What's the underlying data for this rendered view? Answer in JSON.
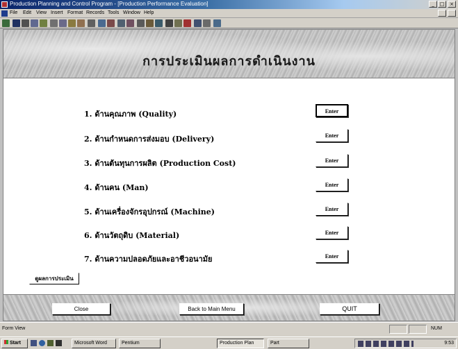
{
  "window": {
    "title": "Production Planning and Control Program - [Production Performance Evaluation]",
    "controls": [
      "_",
      "□",
      "×"
    ]
  },
  "menubar": {
    "items": [
      "File",
      "Edit",
      "View",
      "Insert",
      "Format",
      "Records",
      "Tools",
      "Window",
      "Help"
    ]
  },
  "form": {
    "title": "การประเมินผลการดำเนินงาน",
    "criteria": [
      {
        "label": "1. ด้านคุณภาพ (Quality)",
        "button": "Enter"
      },
      {
        "label": "2. ด้านกำหนดการส่งมอบ (Delivery)",
        "button": "Enter"
      },
      {
        "label": "3. ด้านต้นทุนการผลิต (Production Cost)",
        "button": "Enter"
      },
      {
        "label": "4. ด้านคน (Man)",
        "button": "Enter"
      },
      {
        "label": "5. ด้านเครื่องจักรอุปกรณ์ (Machine)",
        "button": "Enter"
      },
      {
        "label": "6. ด้านวัตถุดิบ (Material)",
        "button": "Enter"
      },
      {
        "label": "7. ด้านความปลอดภัยและอาชีวอนามัย",
        "button": "Enter"
      }
    ],
    "subform_button": "ดูผลการประเมิน",
    "footer": {
      "close": "Close",
      "back": "Back to Main Menu",
      "quit": "QUIT"
    }
  },
  "statusbar": {
    "text": "Form View",
    "num": "NUM"
  },
  "taskbar": {
    "start": "Start",
    "tasks": [
      "Microsoft Word",
      "Pentium",
      "Production Plan",
      "Part"
    ],
    "clock": "9:53"
  },
  "colors": {
    "titlebar_start": "#0a246a",
    "titlebar_end": "#a6caf0",
    "chrome": "#d4d0c8",
    "form_bg": "#ffffff"
  }
}
